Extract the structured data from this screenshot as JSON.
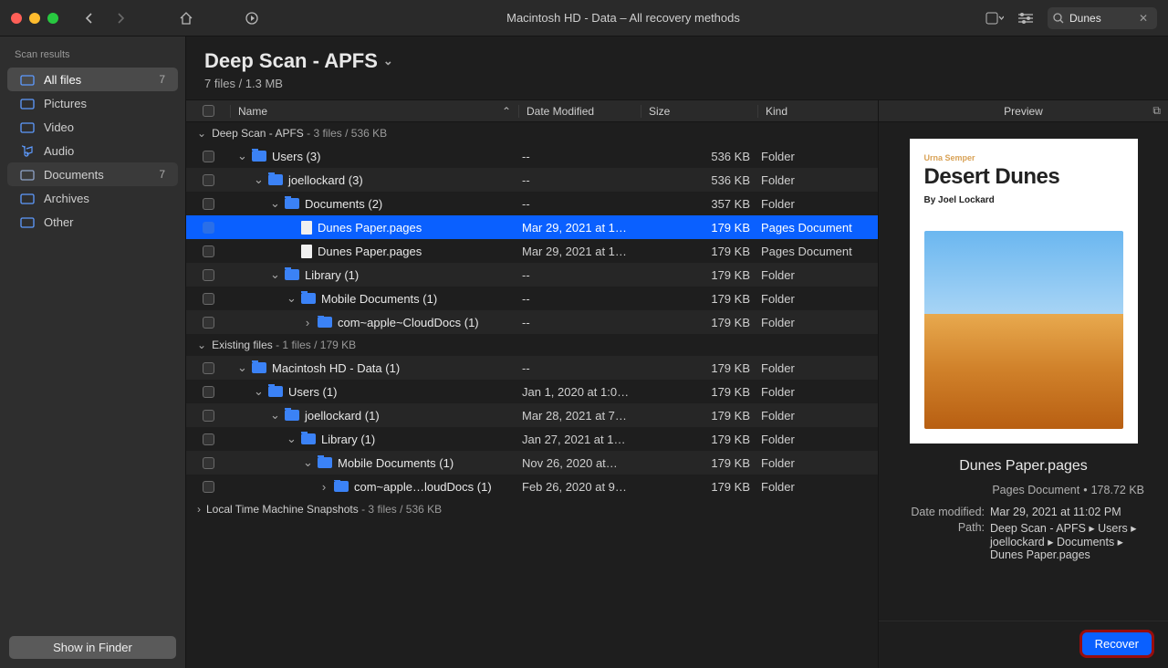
{
  "titlebar": {
    "title": "Macintosh HD - Data – All recovery methods",
    "search_value": "Dunes"
  },
  "sidebar": {
    "header": "Scan results",
    "items": [
      {
        "label": "All files",
        "count": "7",
        "active": true
      },
      {
        "label": "Pictures",
        "count": ""
      },
      {
        "label": "Video",
        "count": ""
      },
      {
        "label": "Audio",
        "count": ""
      },
      {
        "label": "Documents",
        "count": "7"
      },
      {
        "label": "Archives",
        "count": ""
      },
      {
        "label": "Other",
        "count": ""
      }
    ],
    "show_in_finder": "Show in Finder"
  },
  "content": {
    "title": "Deep Scan - APFS",
    "subtitle": "7 files / 1.3 MB"
  },
  "columns": {
    "name": "Name",
    "date": "Date Modified",
    "size": "Size",
    "kind": "Kind"
  },
  "groups": [
    {
      "label": "Deep Scan - APFS",
      "stats": "3 files / 536 KB",
      "expanded": true
    },
    {
      "label": "Existing files",
      "stats": "1 files / 179 KB",
      "expanded": true
    },
    {
      "label": "Local Time Machine Snapshots",
      "stats": "3 files / 536 KB",
      "expanded": false
    }
  ],
  "rows_g0": [
    {
      "indent": 0,
      "chev": "down",
      "icon": "folder",
      "name": "Users (3)",
      "date": "--",
      "size": "536 KB",
      "kind": "Folder"
    },
    {
      "indent": 1,
      "chev": "down",
      "icon": "folder",
      "name": "joellockard (3)",
      "date": "--",
      "size": "536 KB",
      "kind": "Folder"
    },
    {
      "indent": 2,
      "chev": "down",
      "icon": "folder",
      "name": "Documents (2)",
      "date": "--",
      "size": "357 KB",
      "kind": "Folder"
    },
    {
      "indent": 3,
      "chev": "",
      "icon": "file",
      "name": "Dunes Paper.pages",
      "date": "Mar 29, 2021 at 1…",
      "size": "179 KB",
      "kind": "Pages Document",
      "selected": true
    },
    {
      "indent": 3,
      "chev": "",
      "icon": "file",
      "name": "Dunes Paper.pages",
      "date": "Mar 29, 2021 at 1…",
      "size": "179 KB",
      "kind": "Pages Document"
    },
    {
      "indent": 2,
      "chev": "down",
      "icon": "folder",
      "name": "Library (1)",
      "date": "--",
      "size": "179 KB",
      "kind": "Folder"
    },
    {
      "indent": 3,
      "chev": "down",
      "icon": "folder",
      "name": "Mobile Documents (1)",
      "date": "--",
      "size": "179 KB",
      "kind": "Folder"
    },
    {
      "indent": 4,
      "chev": "right",
      "icon": "folder",
      "name": "com~apple~CloudDocs (1)",
      "date": "--",
      "size": "179 KB",
      "kind": "Folder"
    }
  ],
  "rows_g1": [
    {
      "indent": 0,
      "chev": "down",
      "icon": "folder",
      "name": "Macintosh HD - Data (1)",
      "date": "--",
      "size": "179 KB",
      "kind": "Folder"
    },
    {
      "indent": 1,
      "chev": "down",
      "icon": "folder",
      "name": "Users (1)",
      "date": "Jan 1, 2020 at 1:0…",
      "size": "179 KB",
      "kind": "Folder"
    },
    {
      "indent": 2,
      "chev": "down",
      "icon": "folder",
      "name": "joellockard (1)",
      "date": "Mar 28, 2021 at 7…",
      "size": "179 KB",
      "kind": "Folder"
    },
    {
      "indent": 3,
      "chev": "down",
      "icon": "folder",
      "name": "Library (1)",
      "date": "Jan 27, 2021 at 1…",
      "size": "179 KB",
      "kind": "Folder"
    },
    {
      "indent": 4,
      "chev": "down",
      "icon": "folder",
      "name": "Mobile Documents (1)",
      "date": "Nov 26, 2020 at…",
      "size": "179 KB",
      "kind": "Folder"
    },
    {
      "indent": 5,
      "chev": "right",
      "icon": "folder",
      "name": "com~apple…loudDocs (1)",
      "date": "Feb 26, 2020 at 9…",
      "size": "179 KB",
      "kind": "Folder"
    }
  ],
  "preview": {
    "header": "Preview",
    "doc_brand": "Urna Semper",
    "doc_title": "Desert Dunes",
    "doc_author": "By Joel Lockard",
    "filename": "Dunes Paper.pages",
    "meta_kind": "Pages Document",
    "meta_size": "178.72 KB",
    "date_modified_label": "Date modified:",
    "date_modified_value": "Mar 29, 2021 at 11:02 PM",
    "path_label": "Path:",
    "path_value": "Deep Scan - APFS ▸ Users ▸ joellockard ▸ Documents ▸ Dunes Paper.pages",
    "recover": "Recover"
  }
}
